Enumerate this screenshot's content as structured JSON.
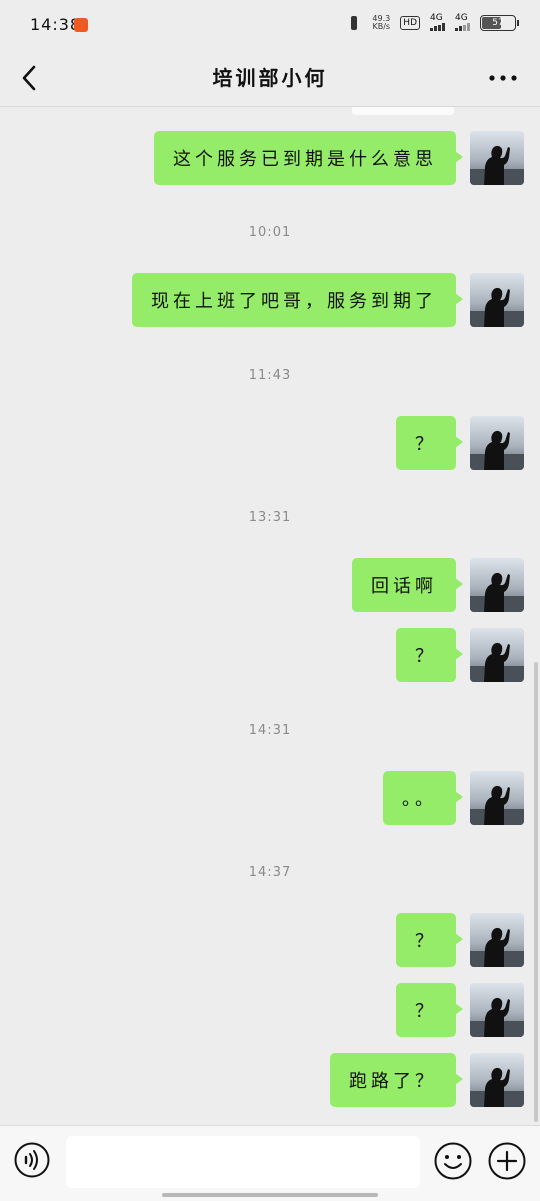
{
  "status_bar": {
    "time": "14:38",
    "net_speed_value": "49.3",
    "net_speed_unit": "KB/s",
    "hd_label": "HD",
    "network_1": "4G",
    "network_2": "4G",
    "battery": "57"
  },
  "header": {
    "title": "培训部小何"
  },
  "messages": [
    {
      "text": "这个服务已到期是什么意思"
    },
    {
      "time": "10:01"
    },
    {
      "text": "现在上班了吧哥，服务到期了"
    },
    {
      "time": "11:43"
    },
    {
      "text": "？"
    },
    {
      "time": "13:31"
    },
    {
      "text": "回话啊"
    },
    {
      "text": "？"
    },
    {
      "time": "14:31"
    },
    {
      "text": "。。"
    },
    {
      "time": "14:37"
    },
    {
      "text": "？"
    },
    {
      "text": "？"
    },
    {
      "text": "跑路了？"
    }
  ],
  "input": {
    "value": "",
    "placeholder": ""
  },
  "icons": {
    "back": "back-arrow-icon",
    "more": "more-dots-icon",
    "voice": "voice-icon",
    "emoji": "emoji-icon",
    "plus": "plus-icon"
  },
  "colors": {
    "bubble": "#95ec69",
    "background": "#ededed"
  }
}
